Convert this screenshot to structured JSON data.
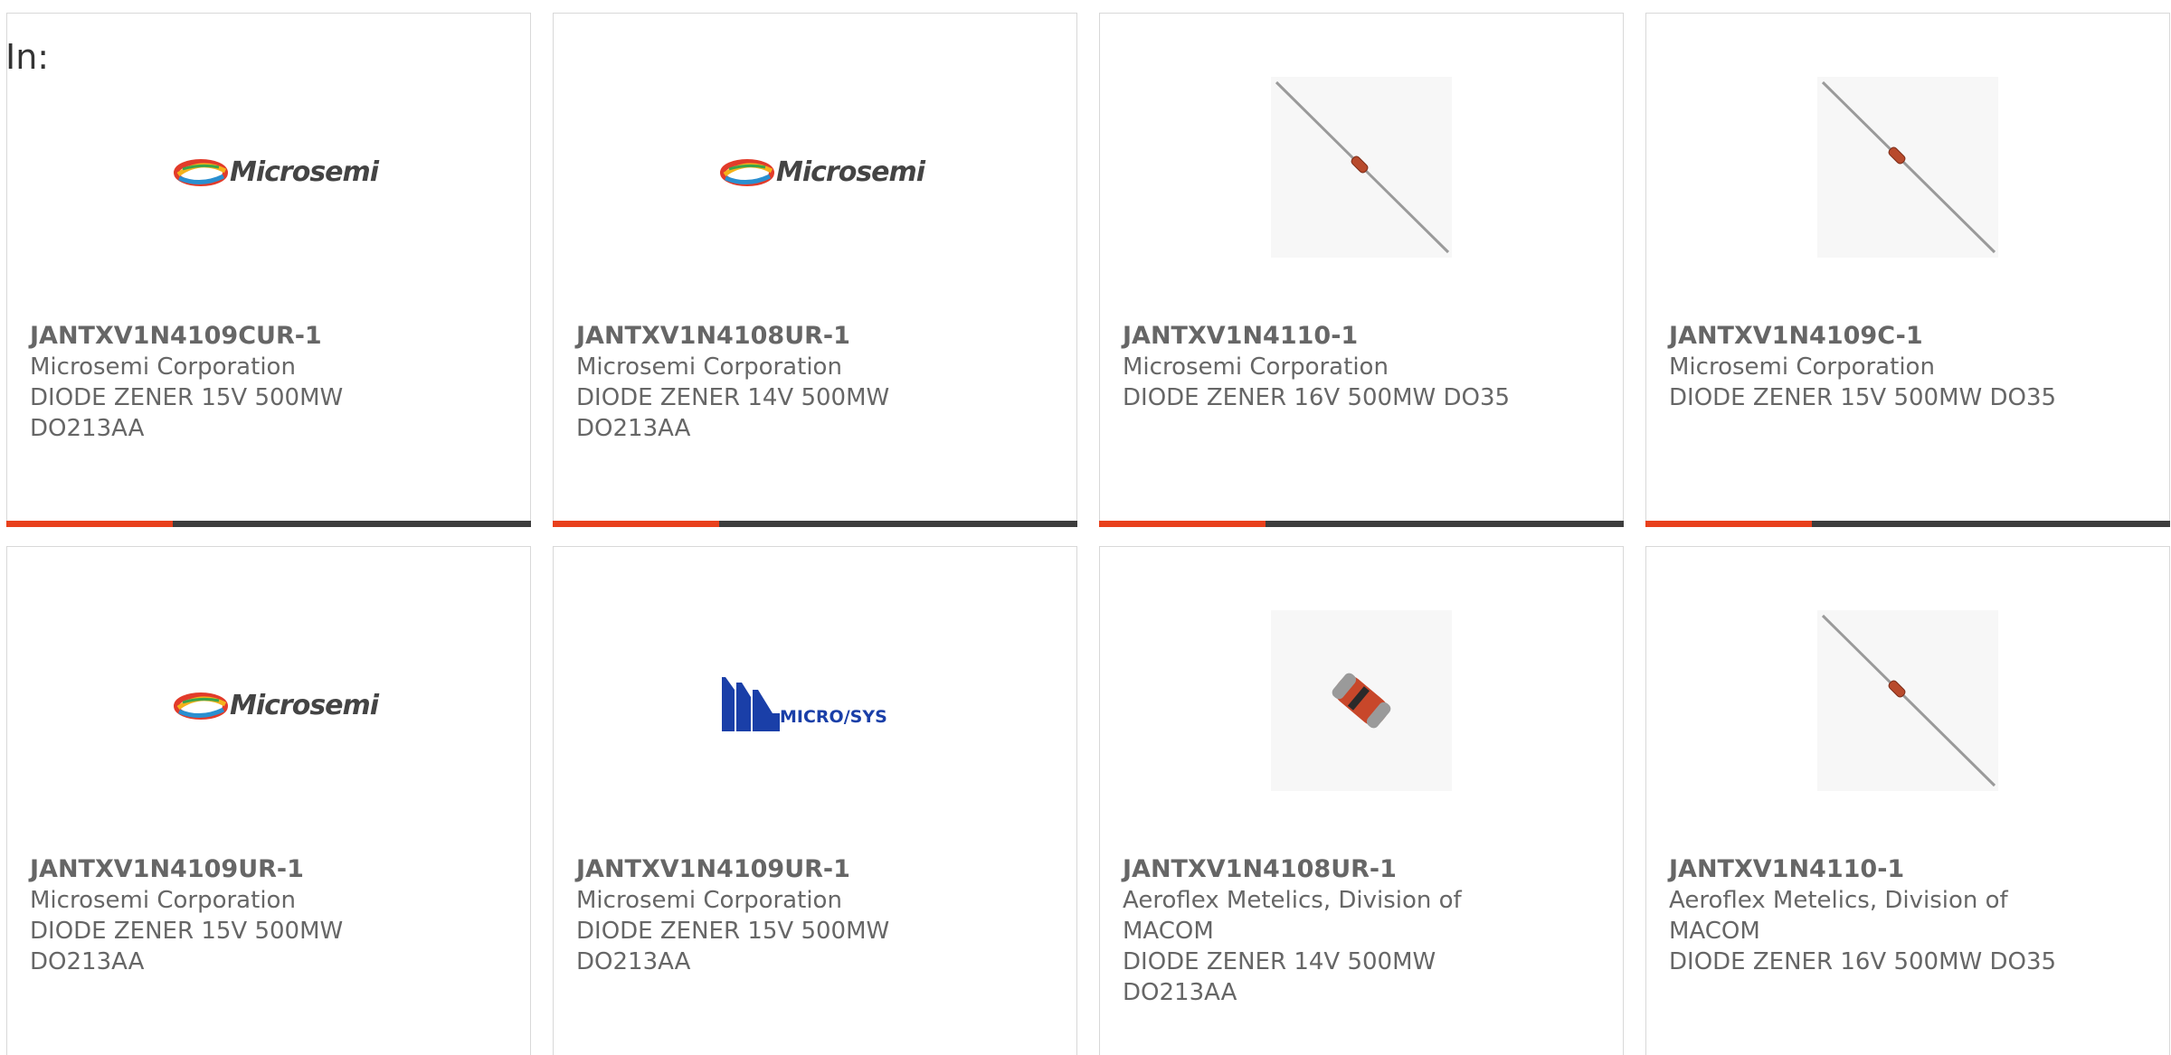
{
  "filter_label": "In:",
  "colors": {
    "accent": "#e8401c",
    "bar_dark": "#3d3d3d",
    "text": "#666666"
  },
  "products": [
    {
      "part_number": "JANTXV1N4109CUR-1",
      "manufacturer": "Microsemi Corporation",
      "description": "DIODE ZENER 15V 500MW DO213AA",
      "image": "microsemi-logo"
    },
    {
      "part_number": "JANTXV1N4108UR-1",
      "manufacturer": "Microsemi Corporation",
      "description": "DIODE ZENER 14V 500MW DO213AA",
      "image": "microsemi-logo"
    },
    {
      "part_number": "JANTXV1N4110-1",
      "manufacturer": "Microsemi Corporation",
      "description": "DIODE ZENER 16V 500MW DO35",
      "image": "axial-diode-photo"
    },
    {
      "part_number": "JANTXV1N4109C-1",
      "manufacturer": "Microsemi Corporation",
      "description": "DIODE ZENER 15V 500MW DO35",
      "image": "axial-diode-photo"
    },
    {
      "part_number": "JANTXV1N4109UR-1",
      "manufacturer": "Microsemi Corporation",
      "description": "DIODE ZENER 15V 500MW DO213AA",
      "image": "microsemi-logo"
    },
    {
      "part_number": "JANTXV1N4109UR-1",
      "manufacturer": "Microsemi Corporation",
      "description": "DIODE ZENER 15V 500MW DO213AA",
      "image": "microsys-logo",
      "logo_text": "MICRO/SYS"
    },
    {
      "part_number": "JANTXV1N4108UR-1",
      "manufacturer": "Aeroflex Metelics, Division of MACOM",
      "description": "DIODE ZENER 14V 500MW DO213AA",
      "image": "melf-diode-photo"
    },
    {
      "part_number": "JANTXV1N4110-1",
      "manufacturer": "Aeroflex Metelics, Division of MACOM",
      "description": "DIODE ZENER 16V 500MW DO35",
      "image": "axial-diode-photo"
    }
  ],
  "logo_texts": {
    "microsemi": "Microsemi",
    "microsys": "MICRO/SYS"
  }
}
